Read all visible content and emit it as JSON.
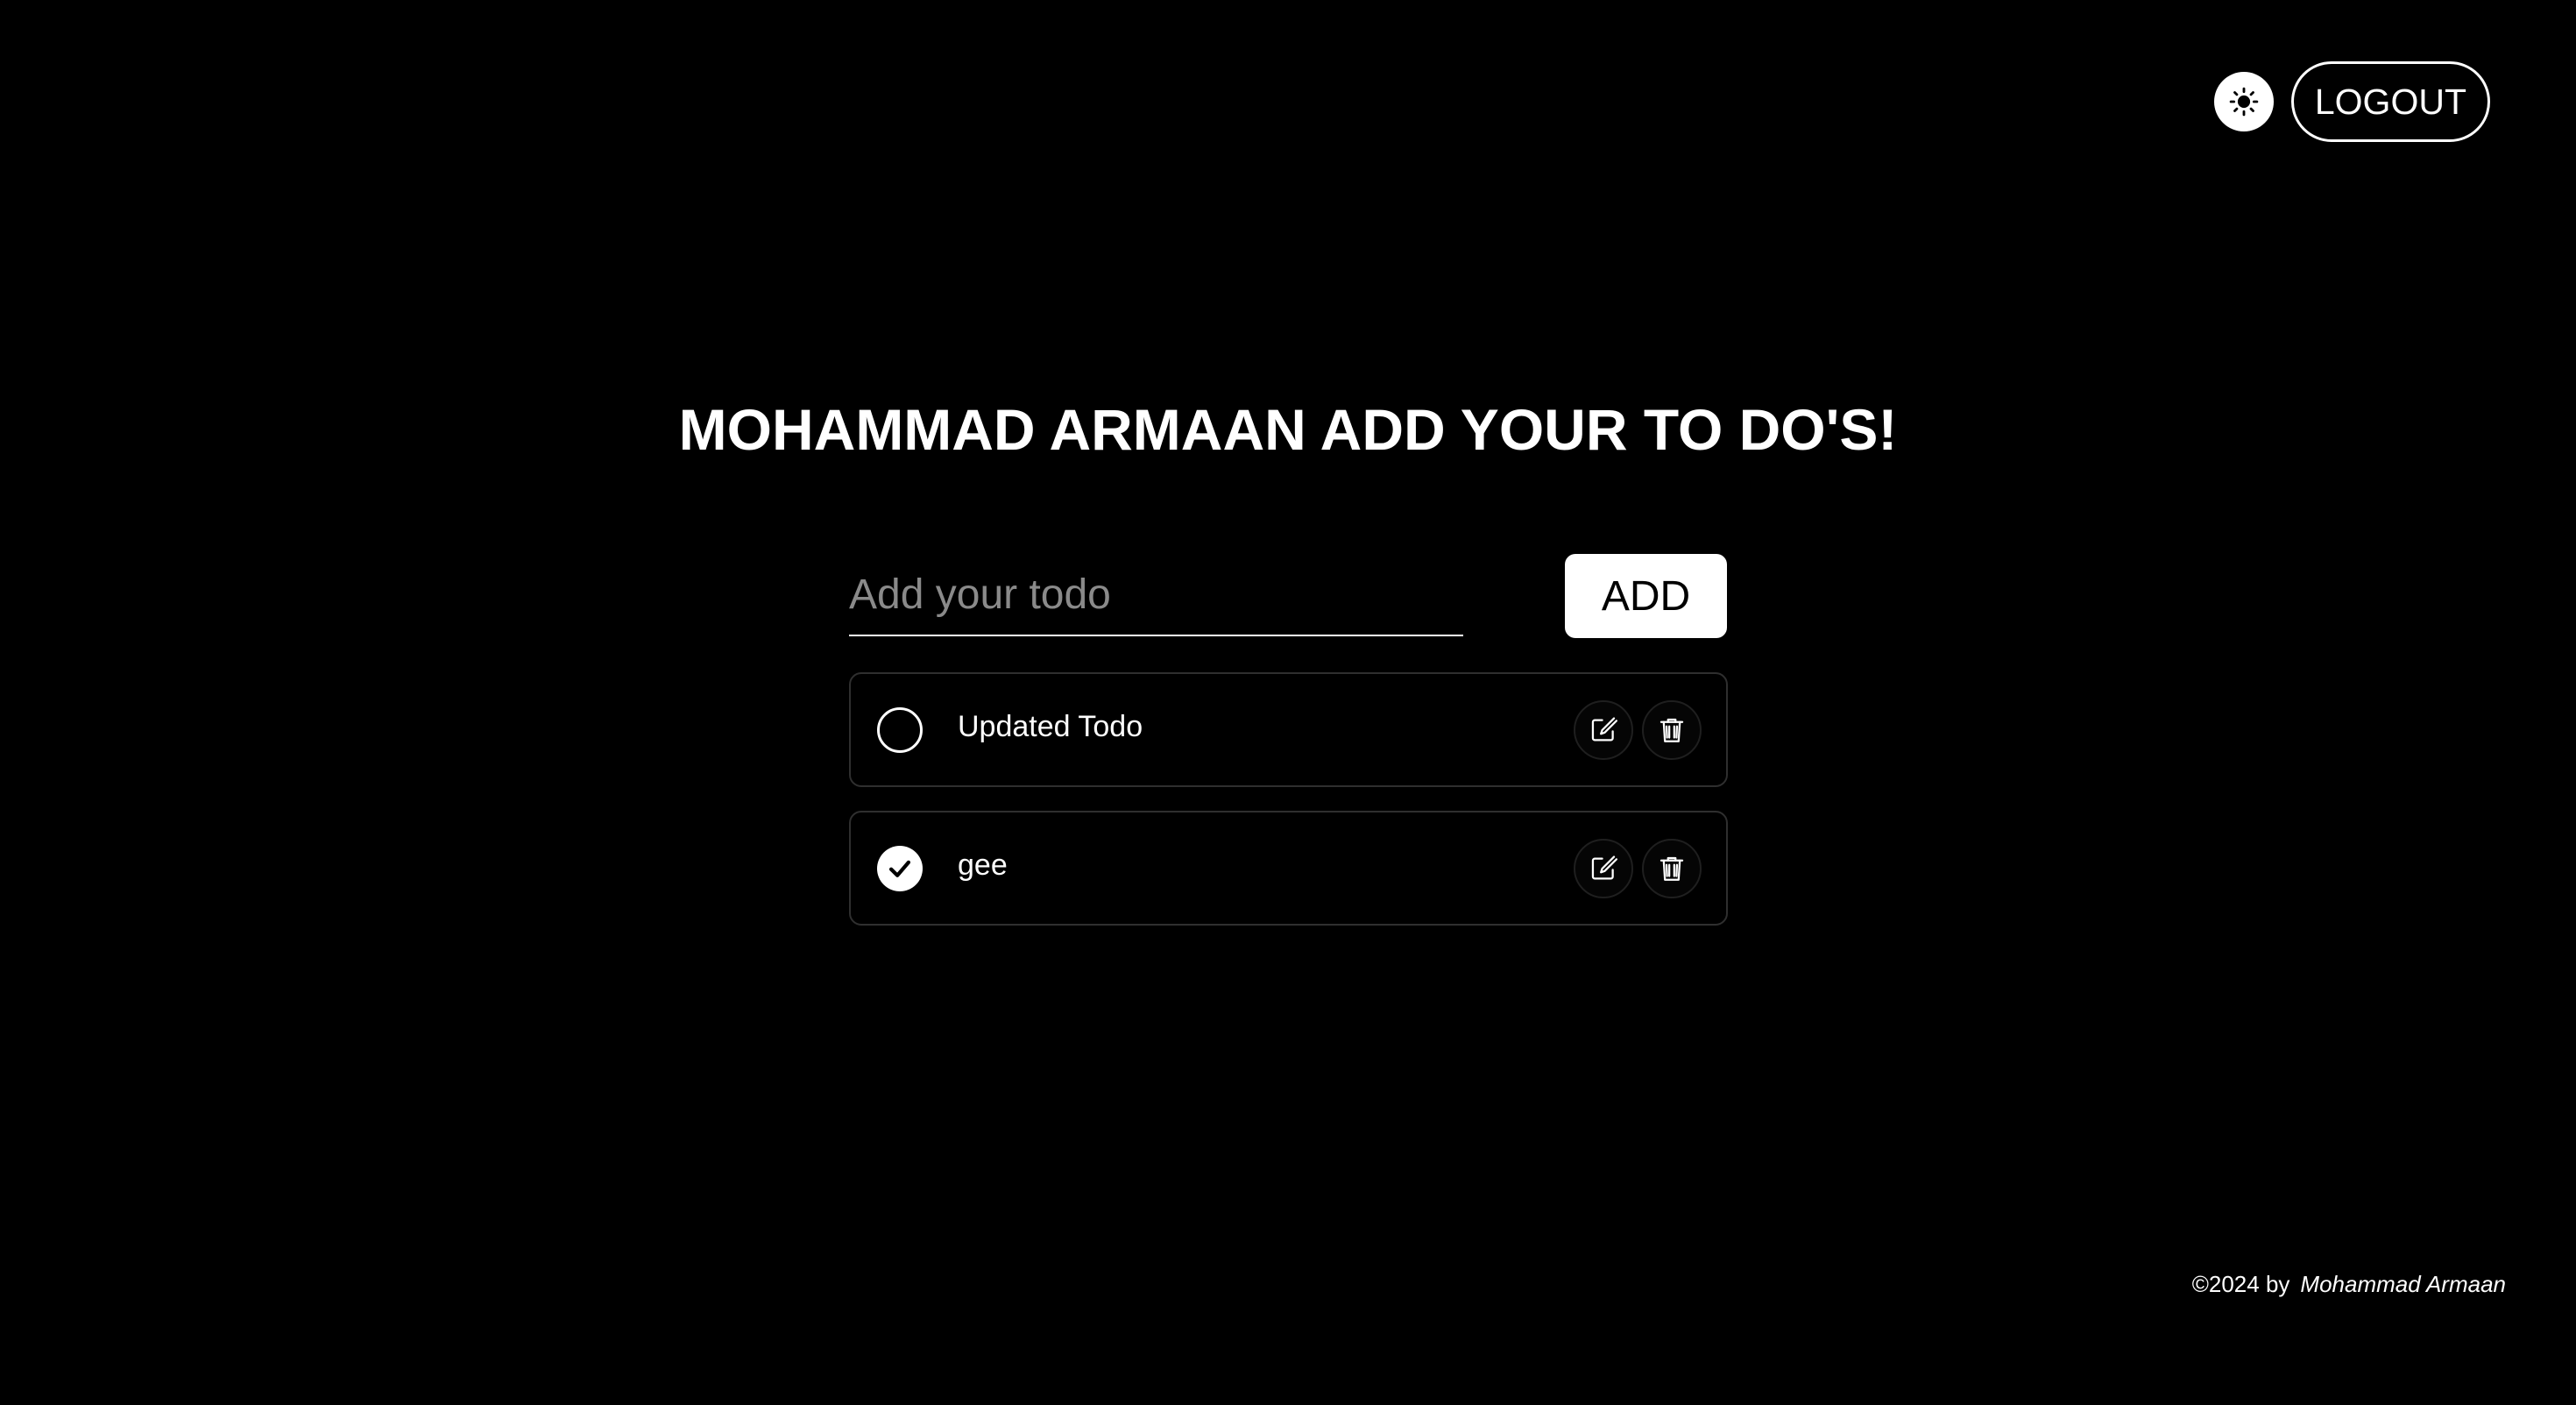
{
  "header": {
    "theme_toggle_icon": "sun-icon",
    "logout_label": "LOGOUT"
  },
  "main": {
    "heading": "MOHAMMAD ARMAAN ADD YOUR TO DO'S!",
    "input_placeholder": "Add your todo",
    "input_value": "",
    "add_label": "ADD"
  },
  "todos": [
    {
      "text": "Updated Todo",
      "completed": false,
      "edit_icon": "edit-icon",
      "delete_icon": "trash-icon"
    },
    {
      "text": "gee",
      "completed": true,
      "edit_icon": "edit-icon",
      "delete_icon": "trash-icon"
    }
  ],
  "footer": {
    "copyright": "©2024 by",
    "author": "Mohammad Armaan"
  },
  "colors": {
    "background": "#000000",
    "foreground": "#ffffff",
    "placeholder": "#8a8a8a",
    "card_border": "#2f2f2f"
  }
}
